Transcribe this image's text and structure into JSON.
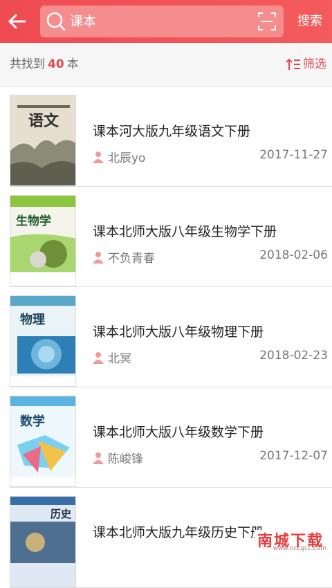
{
  "header": {
    "search_query": "课本",
    "search_button": "搜索"
  },
  "results": {
    "prefix": "共找到",
    "count": "40",
    "suffix": "本",
    "filter_label": "筛选"
  },
  "books": [
    {
      "title": "课本河大版九年级语文下册",
      "author": "北辰yo",
      "date": "2017-11-27",
      "cover_text": "语文",
      "cover_color": "#d9d1c0"
    },
    {
      "title": "课本北师大版八年级生物学下册",
      "author": "不负青春",
      "date": "2018-02-06",
      "cover_text": "生物学",
      "cover_color": "#7fc24e"
    },
    {
      "title": "课本北师大版八年级物理下册",
      "author": "北冥",
      "date": "2018-02-23",
      "cover_text": "物理",
      "cover_color": "#5aa7c7"
    },
    {
      "title": "课本北师大版八年级数学下册",
      "author": "陈峻锋",
      "date": "2017-12-07",
      "cover_text": "数学",
      "cover_color": "#5ab3e0"
    },
    {
      "title": "课本北师大版九年级历史下册",
      "author": "",
      "date": "",
      "cover_text": "历史",
      "cover_color": "#3a6ea8"
    }
  ],
  "watermark": {
    "brand": "南城下载",
    "url": "www.nccgcc.com"
  },
  "colors": {
    "accent": "#e54850",
    "topbar": "#f05253"
  }
}
